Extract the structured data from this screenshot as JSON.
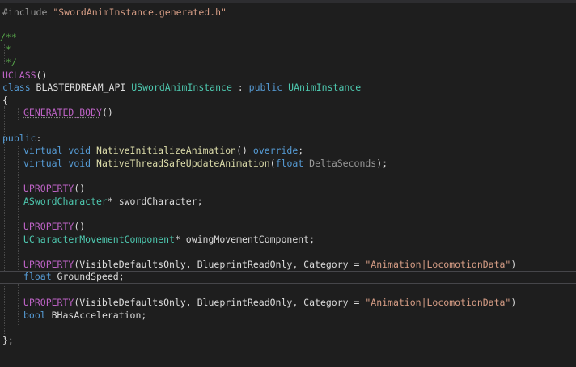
{
  "editor": {
    "colors": {
      "background": "#1e1e1e",
      "keyword": "#569cd6",
      "type": "#4ec9b0",
      "function": "#dcdcaa",
      "macro": "#bd63c5",
      "string": "#d69d85",
      "comment": "#57a64a",
      "parameter": "#9a9a9a"
    },
    "lines": {
      "include": {
        "directive": "#include ",
        "file": "\"SwordAnimInstance.generated.h\""
      },
      "comment_open": "/**",
      "comment_star": " *",
      "comment_close": " */",
      "uclass": {
        "macro": "UCLASS",
        "tail": "()"
      },
      "class_decl": {
        "kw_class": "class",
        "api": " BLASTERDREAM_API ",
        "name": "USwordAnimInstance",
        "colon": " : ",
        "kw_public": "public",
        "space": " ",
        "base": "UAnimInstance"
      },
      "brace_open": "{",
      "generated_body": {
        "macro": "GENERATED_BODY",
        "tail": "()"
      },
      "public_label": {
        "kw": "public",
        "colon": ":"
      },
      "init_anim": {
        "kw_virtual": "virtual",
        "kw_void": " void ",
        "fn": "NativeInitializeAnimation",
        "parens": "() ",
        "kw_override": "override",
        "semi": ";"
      },
      "update_anim": {
        "kw_virtual": "virtual",
        "kw_void": " void ",
        "fn": "NativeThreadSafeUpdateAnimation",
        "open": "(",
        "kw_float": "float",
        "param": " DeltaSeconds",
        "close": ");"
      },
      "uprop1": {
        "macro": "UPROPERTY",
        "tail": "()"
      },
      "sword_char": {
        "type": "ASwordCharacter",
        "rest": "* swordCharacter;"
      },
      "uprop2": {
        "macro": "UPROPERTY",
        "tail": "()"
      },
      "move_comp": {
        "type": "UCharacterMovementComponent",
        "rest": "* owingMovementComponent;"
      },
      "uprop3": {
        "macro": "UPROPERTY",
        "args": "(VisibleDefaultsOnly, BlueprintReadOnly, Category = ",
        "str": "\"Animation|LocomotionData\"",
        "close": ")"
      },
      "ground_speed": {
        "kw": "float",
        "rest": " GroundSpeed;"
      },
      "uprop4": {
        "macro": "UPROPERTY",
        "args": "(VisibleDefaultsOnly, BlueprintReadOnly, Category = ",
        "str": "\"Animation|LocomotionData\"",
        "close": ")"
      },
      "has_accel": {
        "kw": "bool",
        "rest": " BHasAcceleration;"
      },
      "brace_close": "};"
    }
  }
}
